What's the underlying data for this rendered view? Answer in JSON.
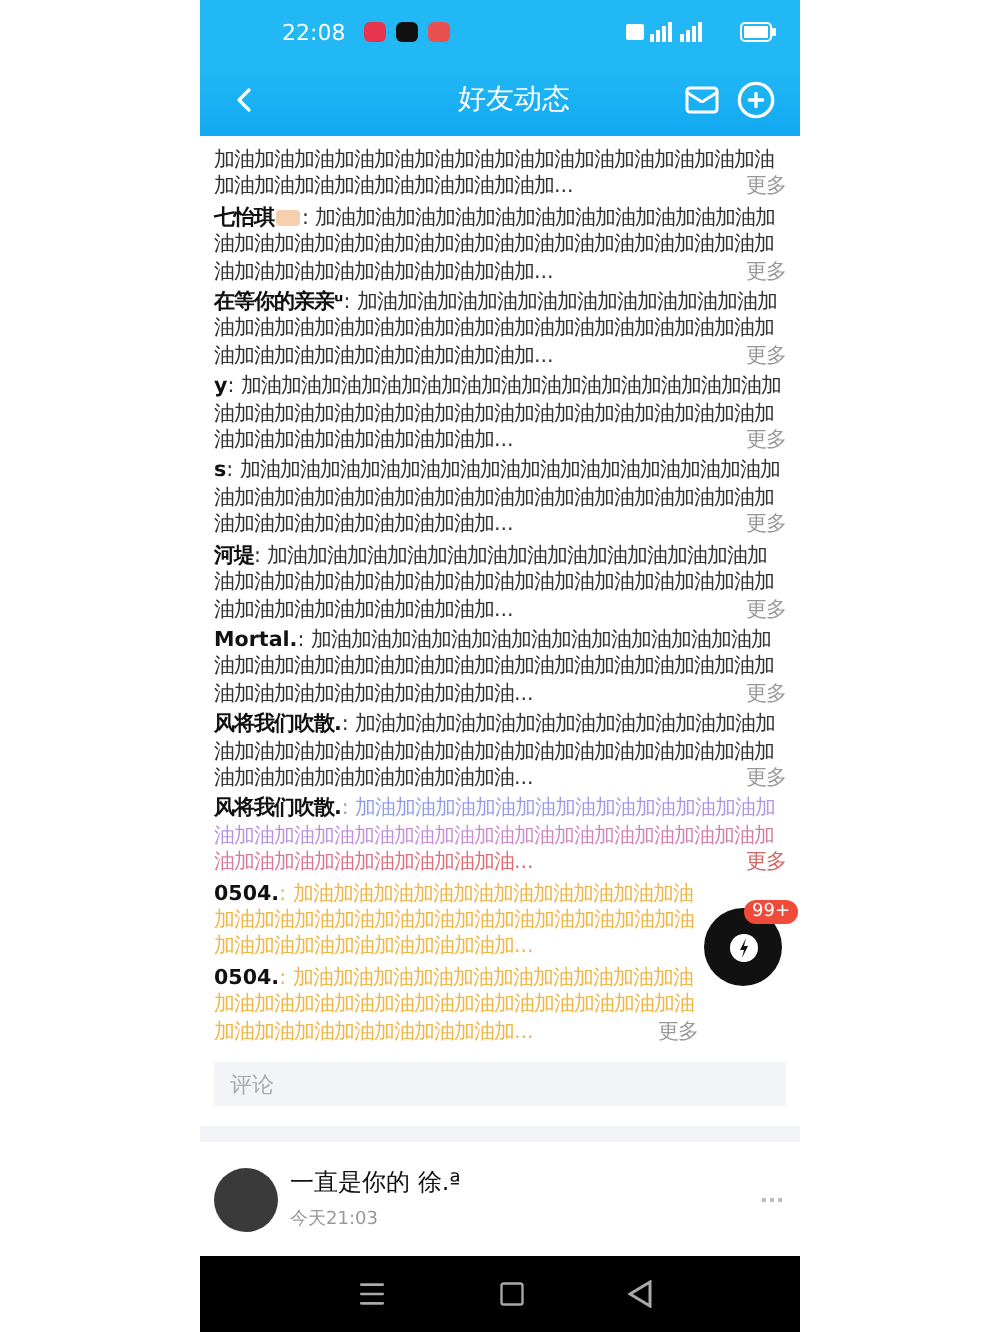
{
  "status_bar": {
    "time": "22:08"
  },
  "header": {
    "title": "好友动态"
  },
  "comments": [
    {
      "kind": "plain",
      "text": "加油加油加油加油加油加油加油加油加油加油加油加油加油加油加油加油加油加油加油加油加油加油加...",
      "more": "更多"
    },
    {
      "kind": "plain",
      "author": "七怡琪",
      "badge": true,
      "text": ": 加油加油加油加油加油加油加油加油加油加油加油加油加油加油加油加油加油加油加油加油加油加油加油加油加油加油加油加油加油加油加油加油加油加...",
      "more": "更多"
    },
    {
      "kind": "plain",
      "author": "在等你的亲亲ᵘ",
      "badge": false,
      "text": ": 加油加油加油加油加油加油加油加油加油加油加油加油加油加油加油加油加油加油加油加油加油加油加油加油加油加油加油加油加油加油加油加油加...",
      "more": "更多"
    },
    {
      "kind": "plain",
      "author": "y",
      "badge": false,
      "text": ": 加油加油加油加油加油加油加油加油加油加油加油加油加油加油加油加油加油加油加油加油加油加油加油加油加油加油加油加油加油加油加油加油加油加油加...",
      "more": "更多"
    },
    {
      "kind": "plain",
      "author": "s",
      "badge": false,
      "text": ": 加油加油加油加油加油加油加油加油加油加油加油加油加油加油加油加油加油加油加油加油加油加油加油加油加油加油加油加油加油加油加油加油加油加油加...",
      "more": "更多"
    },
    {
      "kind": "plain",
      "author": "河堤",
      "badge": false,
      "text": ": 加油加油加油加油加油加油加油加油加油加油加油加油加油加油加油加油加油加油加油加油加油加油加油加油加油加油加油加油加油加油加油加油加油加...",
      "more": "更多"
    },
    {
      "kind": "plain",
      "author": "Mortal.",
      "badge": false,
      "text": ": 加油加油加油加油加油加油加油加油加油加油加油加油加油加油加油加油加油加油加油加油加油加油加油加油加油加油加油加油加油加油加油加油加油...",
      "more": "更多"
    },
    {
      "kind": "plain",
      "author": "风将我们吹散.",
      "badge": false,
      "text": ": 加油加油加油加油加油加油加油加油加油加油加油加油加油加油加油加油加油加油加油加油加油加油加油加油加油加油加油加油加油加油加油加油...",
      "more": "更多"
    },
    {
      "kind": "gradient",
      "author": "风将我们吹散.",
      "badge": false,
      "text": ": 加油加油加油加油加油加油加油加油加油加油加油加油加油加油加油加油加油加油加油加油加油加油加油加油加油加油加油加油加油加油加油加油...",
      "more": "更多"
    },
    {
      "kind": "gold",
      "author": "0504.",
      "badge": false,
      "text": ": 加油加油加油加油加油加油加油加油加油加油加油加油加油加油加油加油加油加油加油加油加油加油加油加油加油加油加油加油加油加..."
    },
    {
      "kind": "gold",
      "author": "0504.",
      "badge": false,
      "text": ": 加油加油加油加油加油加油加油加油加油加油加油加油加油加油加油加油加油加油加油加油加油加油加油加油加油加油加油加油加油加...",
      "more": "更多"
    }
  ],
  "comment_field": {
    "placeholder": "评论"
  },
  "post": {
    "author": "一直是你的 徐.ª",
    "time": "今天21:03"
  },
  "floating_button": {
    "badge": "99+"
  }
}
